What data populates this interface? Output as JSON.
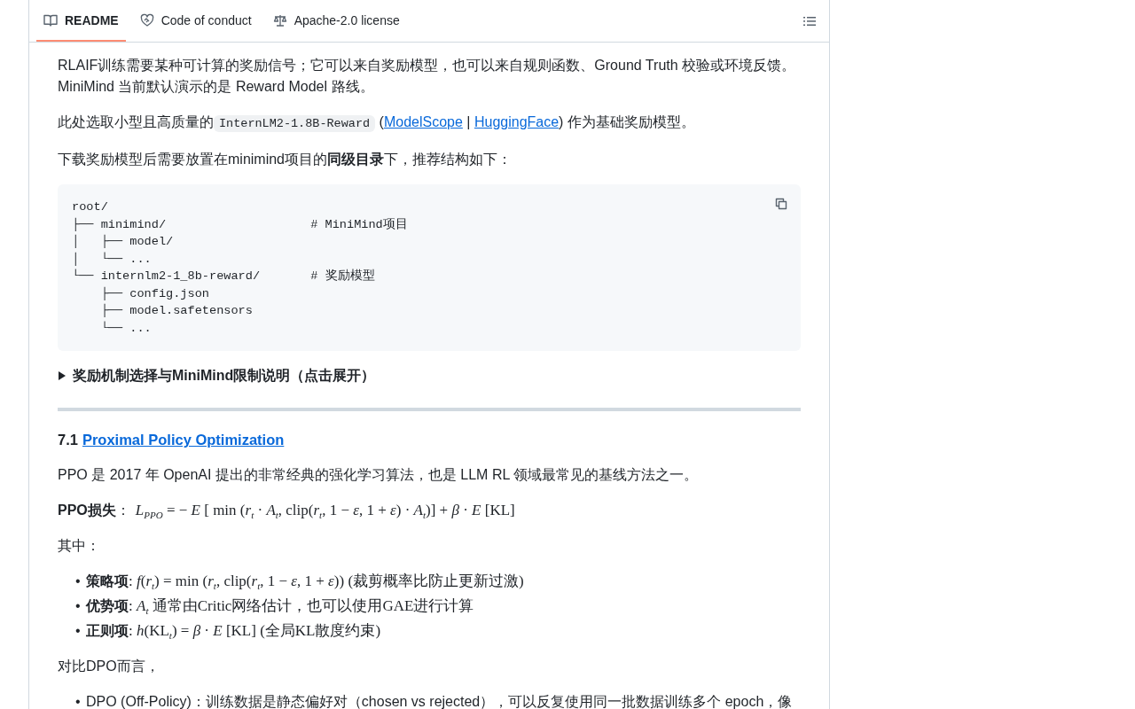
{
  "tabs": [
    {
      "label": "README",
      "selected": true
    },
    {
      "label": "Code of conduct",
      "selected": false
    },
    {
      "label": "Apache-2.0 license",
      "selected": false
    }
  ],
  "blocks": [
    {
      "kind": "paragraph",
      "text": "RLAIF训练需要某种可计算的奖励信号；它可以来自奖励模型，也可以来自规则函数、Ground Truth 校验或环境反馈。MiniMind 当前默认演示的是 Reward Model 路线。"
    },
    {
      "kind": "mixed",
      "parts": [
        {
          "kind": "text",
          "text": "此处选取小型且高质量的"
        },
        {
          "kind": "code",
          "text": "InternLM2-1.8B-Reward"
        },
        {
          "kind": "text",
          "text": " ("
        },
        {
          "kind": "link",
          "text": "ModelScope"
        },
        {
          "kind": "text",
          "text": " | "
        },
        {
          "kind": "link",
          "text": "HuggingFace"
        },
        {
          "kind": "text",
          "text": ") 作为基础奖励模型。"
        }
      ]
    },
    {
      "kind": "paragraph",
      "text": "下载奖励模型后需要放置在minimind项目的**同级目录**下，推荐结构如下："
    },
    {
      "kind": "code",
      "lines": [
        "root/",
        "├── minimind/                    # MiniMind项目",
        "│   ├── model/",
        "│   └── ...",
        "└── internlm2-1_8b-reward/       # 奖励模型",
        "    ├── config.json",
        "    ├── model.safetensors",
        "    └── ..."
      ]
    },
    {
      "kind": "details",
      "expanded": false,
      "text": "奖励机制选择与MiniMind限制说明（点击展开）"
    },
    {
      "kind": "rule"
    },
    {
      "kind": "heading",
      "number": "7.1",
      "link": "Proximal Policy Optimization"
    },
    {
      "kind": "paragraph",
      "text": "PPO 是 2017 年 OpenAI 提出的非常经典的强化学习算法，也是 LLM RL 领域最常见的基线方法之一。"
    },
    {
      "kind": "formula",
      "term": "PPO损失",
      "sep": "：",
      "formula": "*L*$_{PPO}$ = − *E* [ min (*r*$_{t}$ · *A*$_{t}$, clip(*r*$_{t}$, 1 − *ε*, 1 + *ε*) · *A*$_{t}$)] + *β* · *E* [KL]"
    },
    {
      "kind": "paragraph",
      "text": "其中："
    },
    {
      "kind": "list",
      "items": [
        {
          "bullet": "•",
          "term": "策略项",
          "text": ": *f*(*r*$_{t}$) = min (*r*$_{t}$, clip(*r*$_{t}$, 1 − *ε*, 1 + *ε*)) (裁剪概率比防止更新过激)"
        },
        {
          "bullet": "•",
          "term": "优势项",
          "text": ": *A*$_{t}$ 通常由Critic网络估计，也可以使用GAE进行计算"
        },
        {
          "bullet": "•",
          "term": "正则项",
          "text": ": *h*(KL$_{t}$) = *β* · *E* [KL] (全局KL散度约束)"
        }
      ]
    },
    {
      "kind": "paragraph",
      "text": "对比DPO而言，"
    },
    {
      "kind": "list",
      "items": [
        {
          "bullet": "•",
          "text": "DPO (Off-Policy)：训练数据是静态偏好对（chosen vs rejected），可以反复使用同一批数据训练多个 epoch，像"
        }
      ]
    }
  ]
}
